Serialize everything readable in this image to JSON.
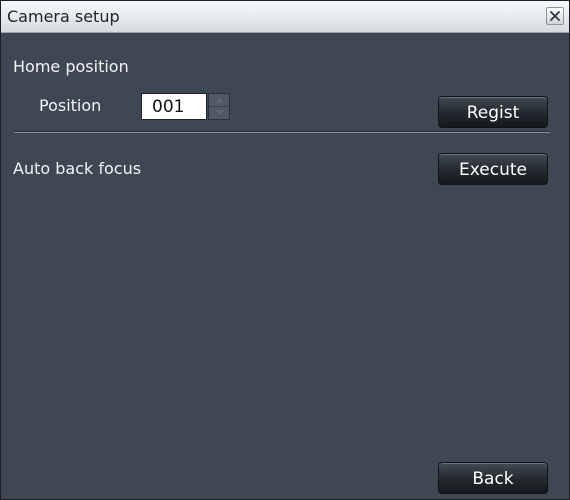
{
  "window": {
    "title": "Camera setup",
    "close_icon": "close-icon"
  },
  "home_position": {
    "heading": "Home position",
    "position_label": "Position",
    "position_value": "001",
    "regist_label": "Regist"
  },
  "auto_back_focus": {
    "label": "Auto back focus",
    "execute_label": "Execute"
  },
  "footer": {
    "back_label": "Back"
  },
  "colors": {
    "panel_bg": "#3e4752",
    "titlebar_bg": "#e6eaee",
    "button_bg": "#22282e",
    "text": "#f2f4f6"
  }
}
